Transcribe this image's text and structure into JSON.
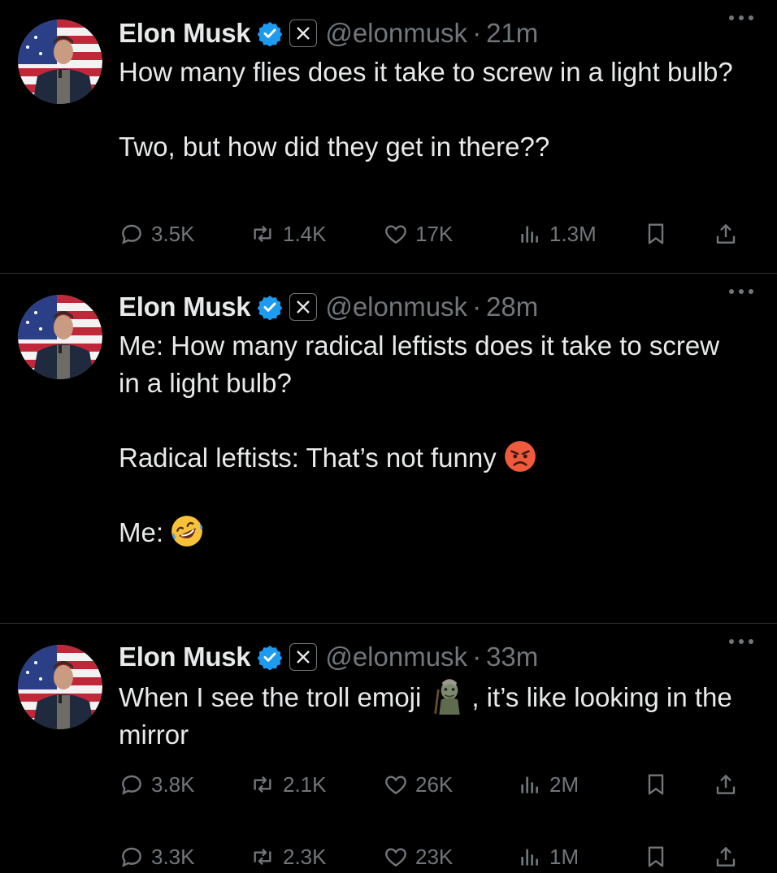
{
  "colors": {
    "background": "#000000",
    "text": "#e7e9ea",
    "muted": "#71767b",
    "verified": "#1d9bf0",
    "divider": "#2f3336"
  },
  "tweets": [
    {
      "author": "Elon Musk",
      "handle": "@elonmusk",
      "separator": "·",
      "time": "21m",
      "body": [
        "How many flies does it take to screw in a light bulb?",
        "",
        "Two, but how did they get in there??"
      ],
      "stats": {
        "replies": "3.5K",
        "reposts": "1.4K",
        "likes": "17K",
        "views": "1.3M"
      }
    },
    {
      "author": "Elon Musk",
      "handle": "@elonmusk",
      "separator": "·",
      "time": "28m",
      "body": [
        "Me: How many radical leftists does it take to screw in a light bulb?",
        "",
        "Radical leftists: That’s not funny",
        "",
        "Me:"
      ],
      "emojis": [
        "angry-face-emoji",
        "rolling-on-floor-laughing-emoji"
      ],
      "stats": {
        "replies": "3.3K",
        "reposts": "2.3K",
        "likes": "23K",
        "views": "1M"
      }
    },
    {
      "author": "Elon Musk",
      "handle": "@elonmusk",
      "separator": "·",
      "time": "33m",
      "body_before": "When I see the troll emoji",
      "body_after": ", it’s like looking in the mirror",
      "emojis": [
        "troll-emoji"
      ],
      "stats": {
        "replies": "3.8K",
        "reposts": "2.1K",
        "likes": "26K",
        "views": "2M"
      }
    }
  ],
  "icons": [
    "reply-icon",
    "repost-icon",
    "like-icon",
    "views-icon",
    "bookmark-icon",
    "share-icon",
    "more-icon",
    "verified-badge-icon",
    "x-affiliate-icon"
  ]
}
